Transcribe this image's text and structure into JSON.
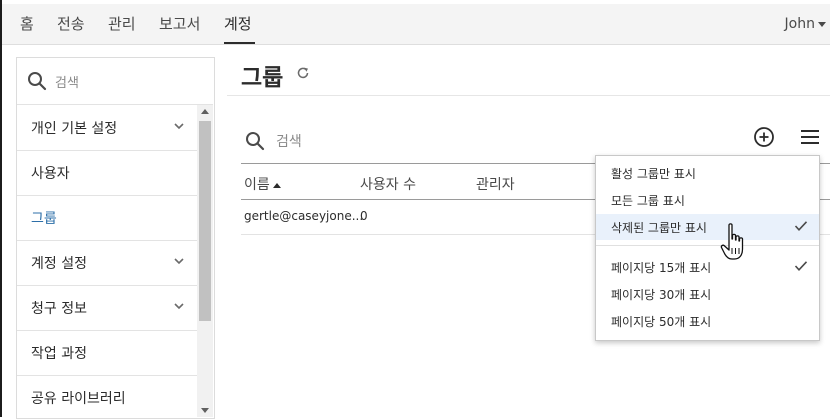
{
  "nav": {
    "items": [
      {
        "label": "홈"
      },
      {
        "label": "전송"
      },
      {
        "label": "관리"
      },
      {
        "label": "보고서"
      },
      {
        "label": "계정",
        "active": true
      }
    ],
    "user": "John"
  },
  "sidebar": {
    "search_placeholder": "검색",
    "items": [
      {
        "label": "개인 기본 설정",
        "expandable": true
      },
      {
        "label": "사용자",
        "expandable": false
      },
      {
        "label": "그룹",
        "expandable": false,
        "active": true
      },
      {
        "label": "계정 설정",
        "expandable": true
      },
      {
        "label": "청구 정보",
        "expandable": true
      },
      {
        "label": "작업 과정",
        "expandable": false
      },
      {
        "label": "공유 라이브러리",
        "expandable": false
      }
    ]
  },
  "main": {
    "title": "그룹",
    "search_placeholder": "검색",
    "table": {
      "columns": [
        "이름",
        "사용자 수",
        "관리자"
      ],
      "rows": [
        {
          "name": "gertle@caseyjone...",
          "users": "0"
        }
      ]
    }
  },
  "dropdown": {
    "items": [
      {
        "label": "활성 그룹만 표시",
        "checked": false
      },
      {
        "label": "모든 그룹 표시",
        "checked": false
      },
      {
        "label": "삭제된 그룹만 표시",
        "checked": true,
        "highlighted": true
      },
      {
        "label": "페이지당 15개 표시",
        "checked": true
      },
      {
        "label": "페이지당 30개 표시",
        "checked": false
      },
      {
        "label": "페이지당 50개 표시",
        "checked": false
      }
    ]
  },
  "colors": {
    "active_link": "#2d6fa8",
    "highlight": "#e9f1fb"
  }
}
